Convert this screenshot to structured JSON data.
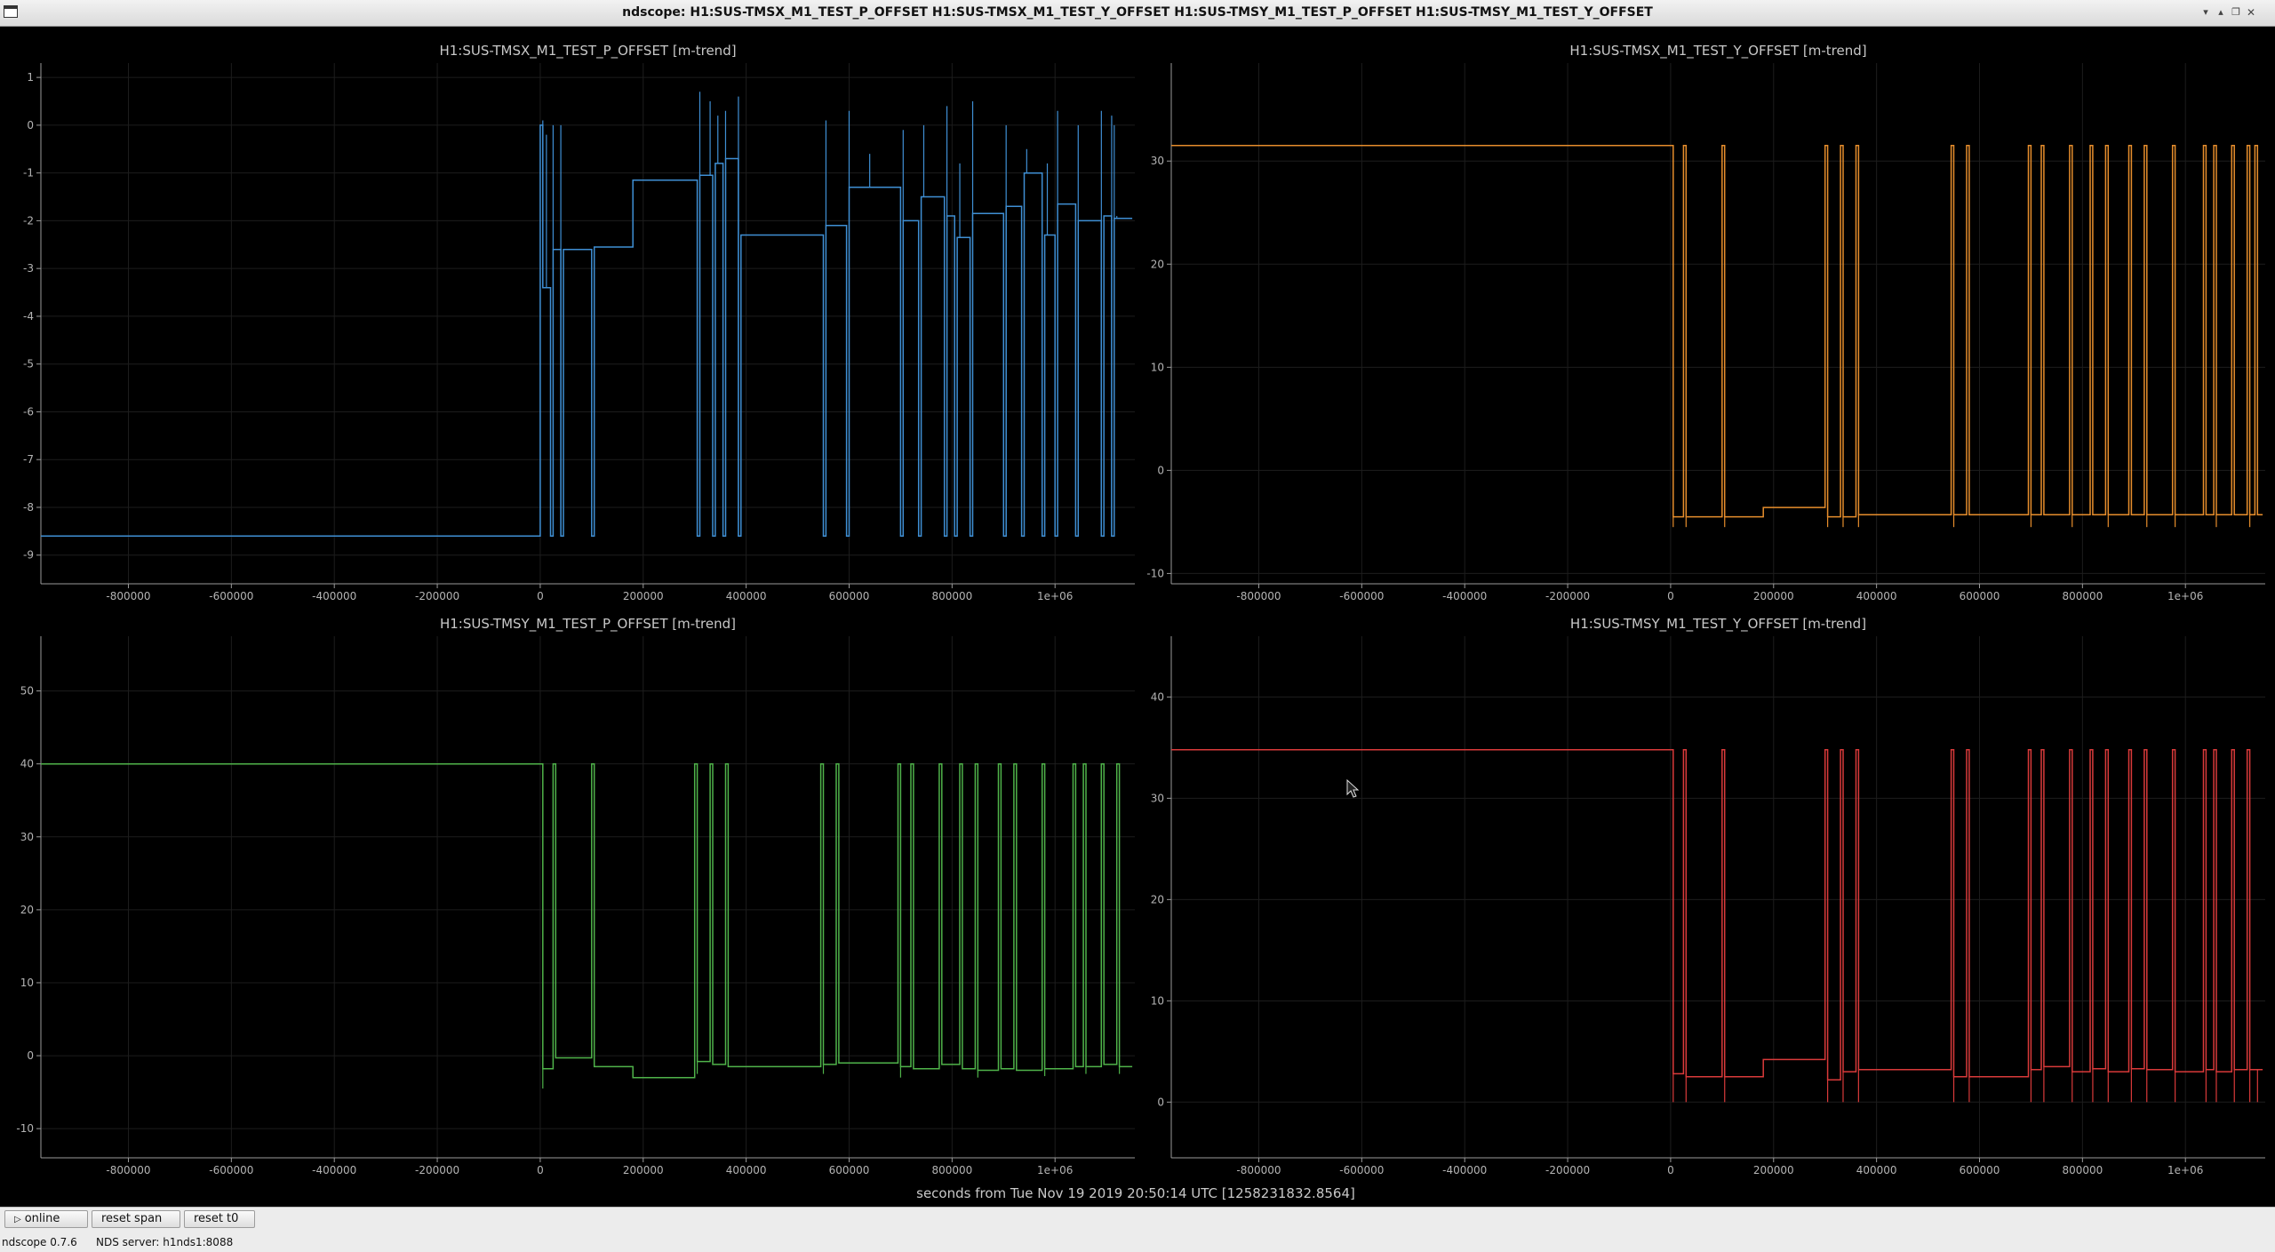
{
  "window": {
    "title": "ndscope: H1:SUS-TMSX_M1_TEST_P_OFFSET H1:SUS-TMSX_M1_TEST_Y_OFFSET H1:SUS-TMSY_M1_TEST_P_OFFSET H1:SUS-TMSY_M1_TEST_Y_OFFSET",
    "controls": [
      "minimize-icon",
      "maximize-icon",
      "restore-icon",
      "close-icon"
    ]
  },
  "x_axis_caption": "seconds from Tue Nov 19 2019 20:50:14 UTC [1258231832.8564]",
  "toolbar": {
    "online_label": "online",
    "online_icon": "play-icon",
    "reset_span_label": "reset span",
    "reset_t0_label": "reset t0"
  },
  "status_bar": {
    "version": "ndscope 0.7.6",
    "server": "NDS server: h1nds1:8088"
  },
  "chart_data": [
    {
      "type": "line",
      "title": "H1:SUS-TMSX_M1_TEST_P_OFFSET [m-trend]",
      "color": "#3f8fd4",
      "xlim": [
        -970000,
        1155000
      ],
      "ylim": [
        -9.6,
        1.3
      ],
      "x_ticks": [
        -800000,
        -600000,
        -400000,
        -200000,
        0,
        200000,
        400000,
        600000,
        800000,
        1000000
      ],
      "x_tick_labels": [
        "-800000",
        "-600000",
        "-400000",
        "-200000",
        "0",
        "200000",
        "400000",
        "600000",
        "800000",
        "1e+06"
      ],
      "y_ticks": [
        1,
        0,
        -1,
        -2,
        -3,
        -4,
        -5,
        -6,
        -7,
        -8,
        -9
      ],
      "y_tick_labels": [
        "1",
        "0",
        "-1",
        "-2",
        "-3",
        "-4",
        "-5",
        "-6",
        "-7",
        "-8",
        "-9"
      ],
      "base": -8.6,
      "steps": [
        [
          -970000,
          -8.6
        ],
        [
          0,
          0
        ],
        [
          5000,
          -3.4
        ],
        [
          20000,
          -8.6
        ],
        [
          25000,
          -2.6
        ],
        [
          40000,
          -8.6
        ],
        [
          45000,
          -2.6
        ],
        [
          100000,
          -8.6
        ],
        [
          105000,
          -2.55
        ],
        [
          180000,
          -1.15
        ],
        [
          305000,
          -8.6
        ],
        [
          310000,
          -1.05
        ],
        [
          335000,
          -8.6
        ],
        [
          340000,
          -0.8
        ],
        [
          355000,
          -8.6
        ],
        [
          360000,
          -0.7
        ],
        [
          385000,
          -8.6
        ],
        [
          390000,
          -2.3
        ],
        [
          550000,
          -8.6
        ],
        [
          555000,
          -2.1
        ],
        [
          595000,
          -8.6
        ],
        [
          600000,
          -1.3
        ],
        [
          700000,
          -8.6
        ],
        [
          705000,
          -2.0
        ],
        [
          735000,
          -8.6
        ],
        [
          740000,
          -1.5
        ],
        [
          785000,
          -8.6
        ],
        [
          790000,
          -1.9
        ],
        [
          805000,
          -8.6
        ],
        [
          810000,
          -2.35
        ],
        [
          835000,
          -8.6
        ],
        [
          840000,
          -1.85
        ],
        [
          900000,
          -8.6
        ],
        [
          905000,
          -1.7
        ],
        [
          935000,
          -8.6
        ],
        [
          940000,
          -1.0
        ],
        [
          975000,
          -8.6
        ],
        [
          980000,
          -2.3
        ],
        [
          1000000,
          -8.6
        ],
        [
          1005000,
          -1.65
        ],
        [
          1040000,
          -8.6
        ],
        [
          1045000,
          -2.0
        ],
        [
          1090000,
          -8.6
        ],
        [
          1095000,
          -1.9
        ],
        [
          1110000,
          -8.6
        ],
        [
          1115000,
          -1.95
        ],
        [
          1150000,
          -1.95
        ]
      ],
      "spikes": [
        [
          5000,
          0.1
        ],
        [
          12000,
          -0.2
        ],
        [
          25000,
          0.0
        ],
        [
          40000,
          0.0
        ],
        [
          310000,
          0.7
        ],
        [
          330000,
          0.5
        ],
        [
          345000,
          0.2
        ],
        [
          360000,
          0.3
        ],
        [
          385000,
          0.6
        ],
        [
          555000,
          0.1
        ],
        [
          600000,
          0.3
        ],
        [
          640000,
          -0.6
        ],
        [
          705000,
          -0.1
        ],
        [
          745000,
          0.0
        ],
        [
          790000,
          0.4
        ],
        [
          815000,
          -0.8
        ],
        [
          840000,
          0.5
        ],
        [
          905000,
          0.0
        ],
        [
          945000,
          -0.5
        ],
        [
          985000,
          -0.8
        ],
        [
          1005000,
          0.3
        ],
        [
          1045000,
          0.0
        ],
        [
          1090000,
          0.3
        ],
        [
          1110000,
          0.2
        ],
        [
          1115000,
          0.0
        ],
        [
          1120000,
          -1.9
        ]
      ]
    },
    {
      "type": "line",
      "title": "H1:SUS-TMSX_M1_TEST_Y_OFFSET [m-trend]",
      "color": "#e68d2c",
      "xlim": [
        -970000,
        1155000
      ],
      "ylim": [
        -11,
        39.5
      ],
      "x_ticks": [
        -800000,
        -600000,
        -400000,
        -200000,
        0,
        200000,
        400000,
        600000,
        800000,
        1000000
      ],
      "x_tick_labels": [
        "-800000",
        "-600000",
        "-400000",
        "-200000",
        "0",
        "200000",
        "400000",
        "600000",
        "800000",
        "1e+06"
      ],
      "y_ticks": [
        30,
        20,
        10,
        0,
        -10
      ],
      "y_tick_labels": [
        "30",
        "20",
        "10",
        "0",
        "-10"
      ],
      "base": 31.5,
      "steps": [
        [
          -970000,
          31.5
        ],
        [
          0,
          31.5
        ],
        [
          5000,
          -4.5
        ],
        [
          25000,
          31.5
        ],
        [
          30000,
          -4.5
        ],
        [
          100000,
          31.5
        ],
        [
          105000,
          -4.5
        ],
        [
          180000,
          -3.6
        ],
        [
          300000,
          31.5
        ],
        [
          305000,
          -4.5
        ],
        [
          330000,
          31.5
        ],
        [
          335000,
          -4.5
        ],
        [
          360000,
          31.5
        ],
        [
          365000,
          -4.3
        ],
        [
          545000,
          31.5
        ],
        [
          550000,
          -4.3
        ],
        [
          575000,
          31.5
        ],
        [
          580000,
          -4.3
        ],
        [
          695000,
          31.5
        ],
        [
          700000,
          -4.3
        ],
        [
          720000,
          31.5
        ],
        [
          725000,
          -4.3
        ],
        [
          775000,
          31.5
        ],
        [
          780000,
          -4.3
        ],
        [
          815000,
          31.5
        ],
        [
          820000,
          -4.3
        ],
        [
          845000,
          31.5
        ],
        [
          850000,
          -4.3
        ],
        [
          890000,
          31.5
        ],
        [
          895000,
          -4.3
        ],
        [
          920000,
          31.5
        ],
        [
          925000,
          -4.3
        ],
        [
          975000,
          31.5
        ],
        [
          980000,
          -4.3
        ],
        [
          1035000,
          31.5
        ],
        [
          1040000,
          -4.3
        ],
        [
          1055000,
          31.5
        ],
        [
          1060000,
          -4.3
        ],
        [
          1090000,
          31.5
        ],
        [
          1095000,
          -4.3
        ],
        [
          1120000,
          31.5
        ],
        [
          1125000,
          -4.3
        ],
        [
          1135000,
          31.5
        ],
        [
          1140000,
          -4.3
        ],
        [
          1150000,
          -4.3
        ]
      ],
      "spikes": [
        [
          5000,
          -5.5
        ],
        [
          30000,
          -5.5
        ],
        [
          105000,
          -5.5
        ],
        [
          305000,
          -5.5
        ],
        [
          335000,
          -5.5
        ],
        [
          365000,
          -5.5
        ],
        [
          550000,
          -5.5
        ],
        [
          700000,
          -5.5
        ],
        [
          780000,
          -5.5
        ],
        [
          850000,
          -5.5
        ],
        [
          925000,
          -5.5
        ],
        [
          980000,
          -5.5
        ],
        [
          1060000,
          -5.5
        ],
        [
          1125000,
          -5.5
        ]
      ]
    },
    {
      "type": "line",
      "title": "H1:SUS-TMSY_M1_TEST_P_OFFSET [m-trend]",
      "color": "#4fb34a",
      "xlim": [
        -970000,
        1155000
      ],
      "ylim": [
        -14,
        57.5
      ],
      "x_ticks": [
        -800000,
        -600000,
        -400000,
        -200000,
        0,
        200000,
        400000,
        600000,
        800000,
        1000000
      ],
      "x_tick_labels": [
        "-800000",
        "-600000",
        "-400000",
        "-200000",
        "0",
        "200000",
        "400000",
        "600000",
        "800000",
        "1e+06"
      ],
      "y_ticks": [
        50,
        40,
        30,
        20,
        10,
        0,
        -10
      ],
      "y_tick_labels": [
        "50",
        "40",
        "30",
        "20",
        "10",
        "0",
        "-10"
      ],
      "base": 40,
      "steps": [
        [
          -970000,
          40
        ],
        [
          0,
          40
        ],
        [
          5000,
          -1.8
        ],
        [
          25000,
          40
        ],
        [
          30000,
          -0.3
        ],
        [
          100000,
          40
        ],
        [
          105000,
          -1.5
        ],
        [
          180000,
          -3
        ],
        [
          300000,
          40
        ],
        [
          305000,
          -0.8
        ],
        [
          330000,
          40
        ],
        [
          335000,
          -1.2
        ],
        [
          360000,
          40
        ],
        [
          365000,
          -1.5
        ],
        [
          545000,
          40
        ],
        [
          550000,
          -1.2
        ],
        [
          575000,
          40
        ],
        [
          580000,
          -1.0
        ],
        [
          695000,
          40
        ],
        [
          700000,
          -1.5
        ],
        [
          720000,
          40
        ],
        [
          725000,
          -1.8
        ],
        [
          775000,
          40
        ],
        [
          780000,
          -1.2
        ],
        [
          815000,
          40
        ],
        [
          820000,
          -1.8
        ],
        [
          845000,
          40
        ],
        [
          850000,
          -2.0
        ],
        [
          890000,
          40
        ],
        [
          895000,
          -1.8
        ],
        [
          920000,
          40
        ],
        [
          925000,
          -2.0
        ],
        [
          975000,
          40
        ],
        [
          980000,
          -1.8
        ],
        [
          1035000,
          40
        ],
        [
          1040000,
          -1.5
        ],
        [
          1055000,
          40
        ],
        [
          1060000,
          -1.5
        ],
        [
          1090000,
          40
        ],
        [
          1095000,
          -1.2
        ],
        [
          1120000,
          40
        ],
        [
          1125000,
          -1.5
        ],
        [
          1150000,
          -1.5
        ]
      ],
      "spikes": [
        [
          5000,
          -4.5
        ],
        [
          305000,
          -2.5
        ],
        [
          550000,
          -2.5
        ],
        [
          700000,
          -3
        ],
        [
          850000,
          -3
        ],
        [
          980000,
          -2.8
        ],
        [
          1060000,
          -2.5
        ],
        [
          1125000,
          -2.5
        ]
      ]
    },
    {
      "type": "line",
      "title": "H1:SUS-TMSY_M1_TEST_Y_OFFSET [m-trend]",
      "color": "#d93a3a",
      "xlim": [
        -970000,
        1155000
      ],
      "ylim": [
        -5.5,
        46
      ],
      "x_ticks": [
        -800000,
        -600000,
        -400000,
        -200000,
        0,
        200000,
        400000,
        600000,
        800000,
        1000000
      ],
      "x_tick_labels": [
        "-800000",
        "-600000",
        "-400000",
        "-200000",
        "0",
        "200000",
        "400000",
        "600000",
        "800000",
        "1e+06"
      ],
      "y_ticks": [
        40,
        30,
        20,
        10,
        0
      ],
      "y_tick_labels": [
        "40",
        "30",
        "20",
        "10",
        "0"
      ],
      "base": 34.8,
      "steps": [
        [
          -970000,
          34.8
        ],
        [
          0,
          34.8
        ],
        [
          5000,
          2.8
        ],
        [
          25000,
          34.8
        ],
        [
          30000,
          2.5
        ],
        [
          100000,
          34.8
        ],
        [
          105000,
          2.5
        ],
        [
          180000,
          4.2
        ],
        [
          300000,
          34.8
        ],
        [
          305000,
          2.2
        ],
        [
          330000,
          34.8
        ],
        [
          335000,
          3.0
        ],
        [
          360000,
          34.8
        ],
        [
          365000,
          3.2
        ],
        [
          545000,
          34.8
        ],
        [
          550000,
          2.5
        ],
        [
          575000,
          34.8
        ],
        [
          580000,
          2.5
        ],
        [
          695000,
          34.8
        ],
        [
          700000,
          3.2
        ],
        [
          720000,
          34.8
        ],
        [
          725000,
          3.5
        ],
        [
          775000,
          34.8
        ],
        [
          780000,
          3.0
        ],
        [
          815000,
          34.8
        ],
        [
          820000,
          3.3
        ],
        [
          845000,
          34.8
        ],
        [
          850000,
          3.0
        ],
        [
          890000,
          34.8
        ],
        [
          895000,
          3.3
        ],
        [
          920000,
          34.8
        ],
        [
          925000,
          3.2
        ],
        [
          975000,
          34.8
        ],
        [
          980000,
          3.0
        ],
        [
          1035000,
          34.8
        ],
        [
          1040000,
          3.2
        ],
        [
          1055000,
          34.8
        ],
        [
          1060000,
          3.0
        ],
        [
          1090000,
          34.8
        ],
        [
          1095000,
          3.2
        ],
        [
          1120000,
          34.8
        ],
        [
          1125000,
          3.2
        ],
        [
          1150000,
          3.2
        ]
      ],
      "spikes": [
        [
          5000,
          0
        ],
        [
          30000,
          0
        ],
        [
          105000,
          0
        ],
        [
          305000,
          0
        ],
        [
          335000,
          0
        ],
        [
          365000,
          0
        ],
        [
          550000,
          0
        ],
        [
          580000,
          0
        ],
        [
          700000,
          0
        ],
        [
          725000,
          0
        ],
        [
          780000,
          0
        ],
        [
          820000,
          0
        ],
        [
          850000,
          0
        ],
        [
          895000,
          0
        ],
        [
          925000,
          0
        ],
        [
          980000,
          0
        ],
        [
          1040000,
          0
        ],
        [
          1060000,
          0
        ],
        [
          1095000,
          0
        ],
        [
          1125000,
          0
        ],
        [
          1140000,
          0
        ]
      ]
    }
  ]
}
